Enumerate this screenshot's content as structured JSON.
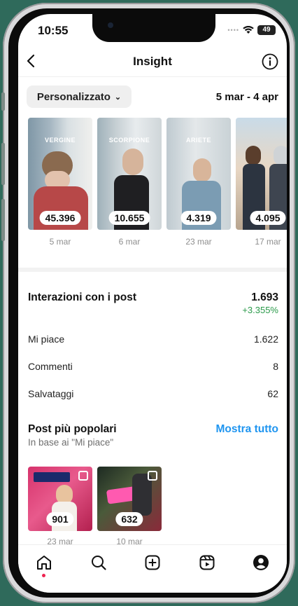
{
  "status": {
    "time": "10:55",
    "battery": "49"
  },
  "header": {
    "title": "Insight"
  },
  "filter": {
    "label": "Personalizzato",
    "date_range": "5 mar - 4 apr"
  },
  "reels": [
    {
      "tag": "VERGINE",
      "count": "45.396",
      "date": "5 mar"
    },
    {
      "tag": "SCORPIONE",
      "count": "10.655",
      "date": "6 mar"
    },
    {
      "tag": "ARIETE",
      "count": "4.319",
      "date": "23 mar"
    },
    {
      "tag": "",
      "count": "4.095",
      "date": "17 mar"
    }
  ],
  "interactions": {
    "title": "Interazioni con i post",
    "total": "1.693",
    "delta": "+3.355%",
    "rows": [
      {
        "label": "Mi piace",
        "value": "1.622"
      },
      {
        "label": "Commenti",
        "value": "8"
      },
      {
        "label": "Salvataggi",
        "value": "62"
      }
    ]
  },
  "popular": {
    "title": "Post più popolari",
    "link": "Mostra tutto",
    "subtitle": "In base ai \"Mi piace\"",
    "posts": [
      {
        "count": "901",
        "date": "23 mar"
      },
      {
        "count": "632",
        "date": "10 mar"
      }
    ]
  },
  "tabs": [
    "home-icon",
    "search-icon",
    "create-icon",
    "reels-icon",
    "profile-icon"
  ]
}
